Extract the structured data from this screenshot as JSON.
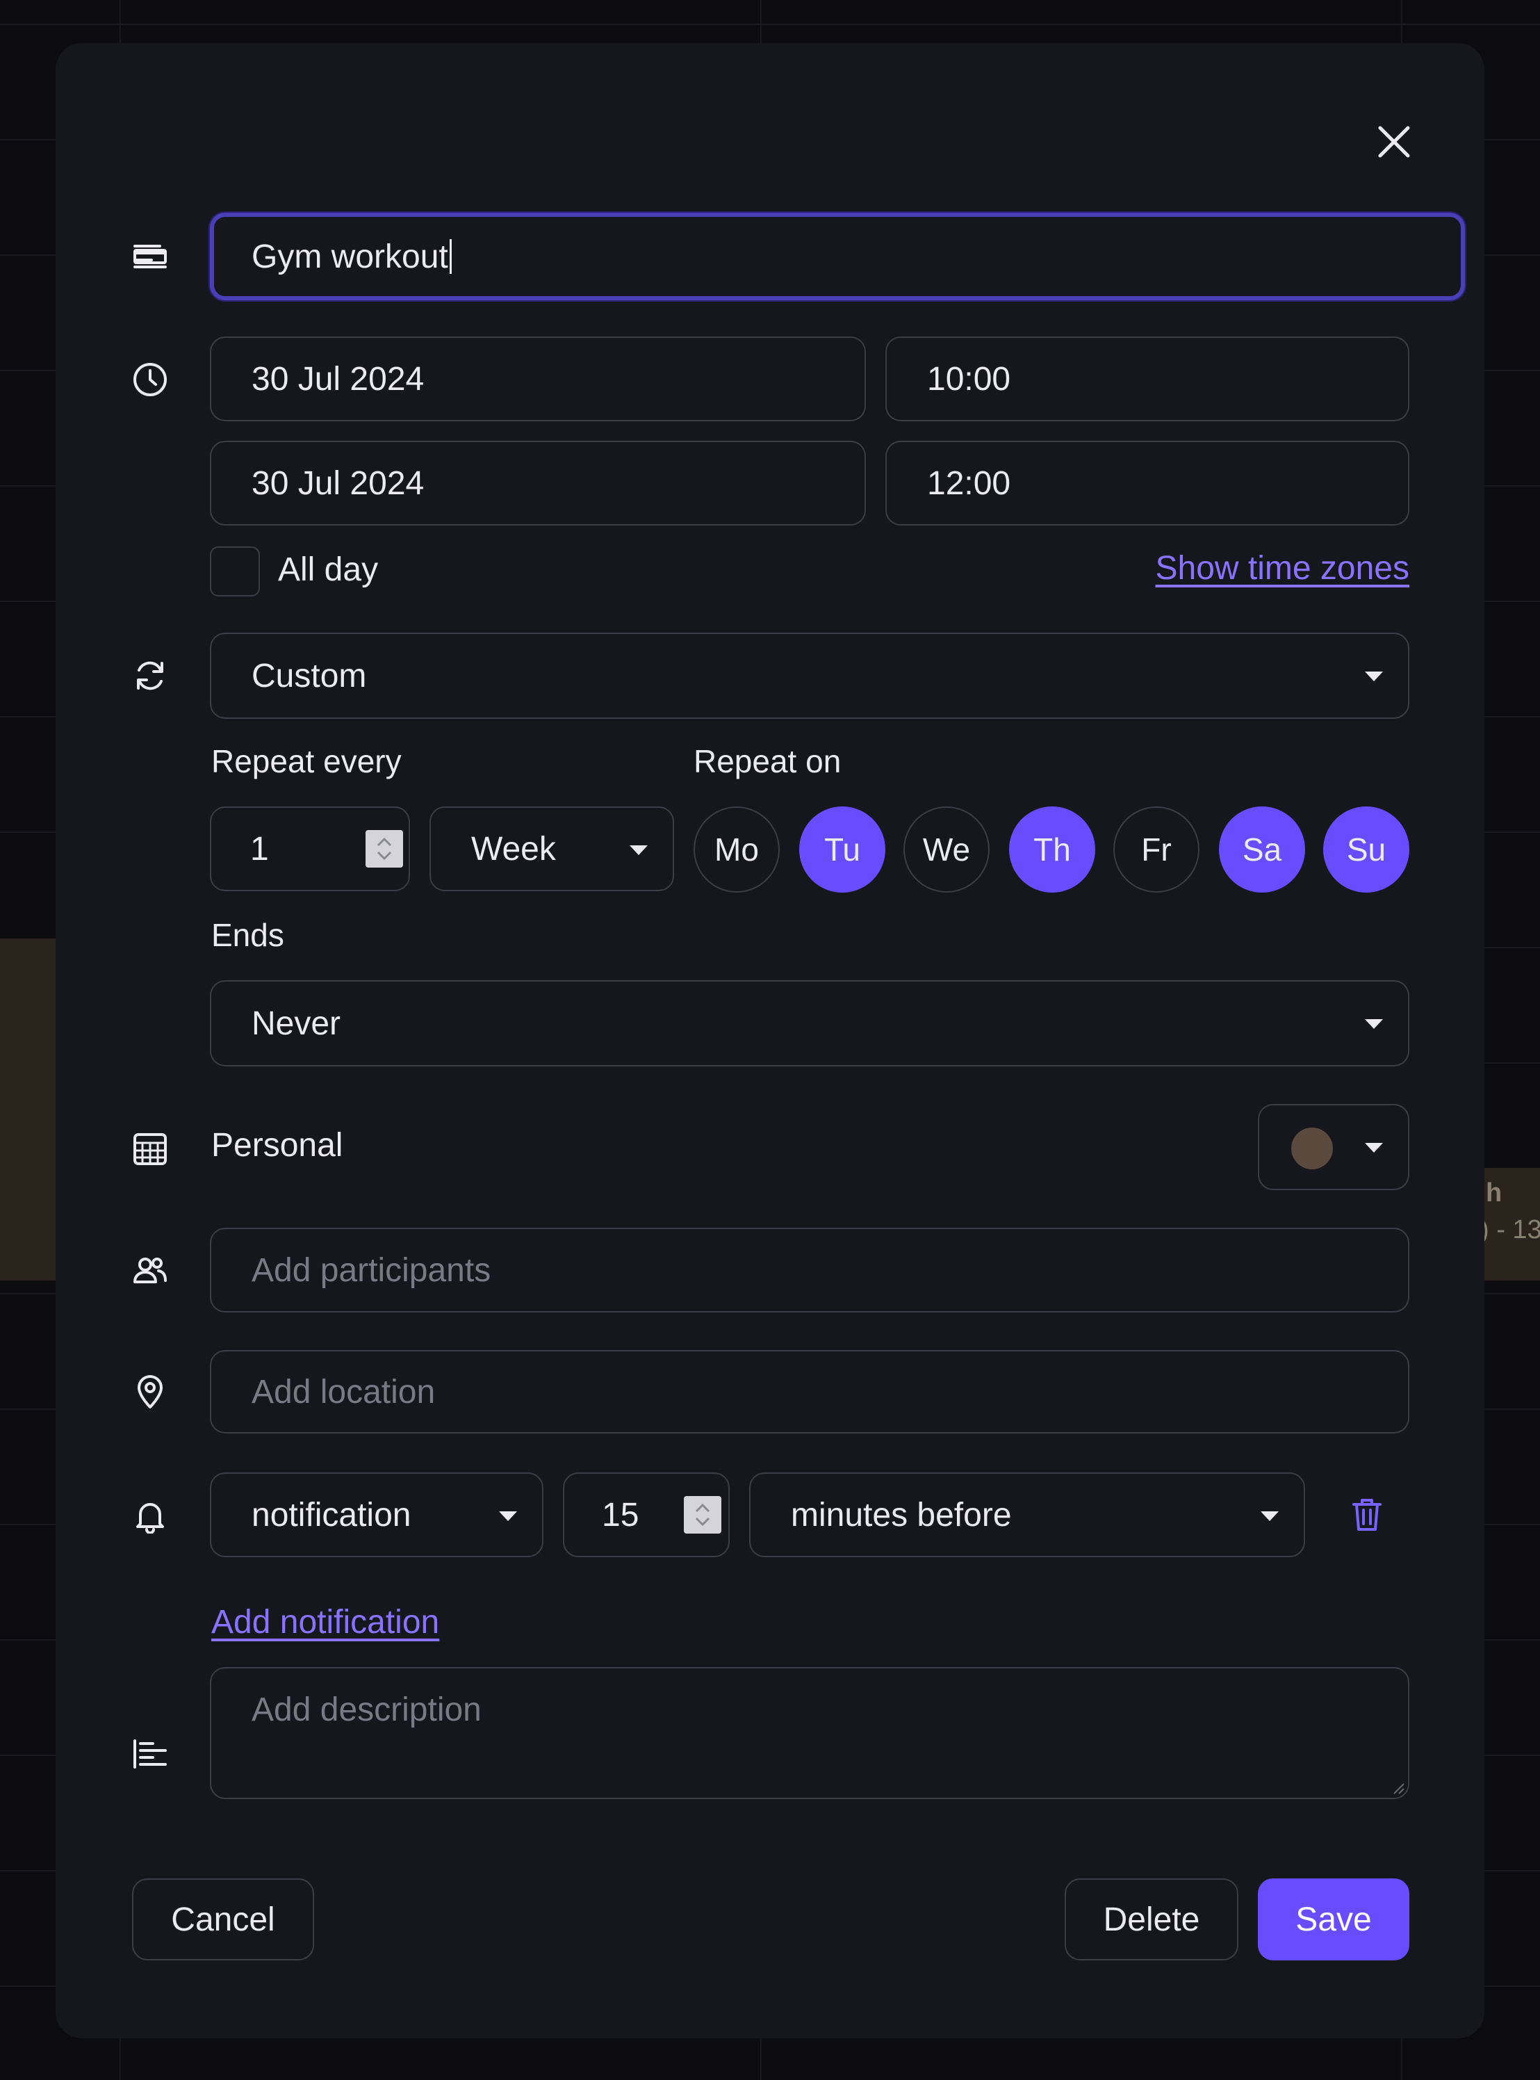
{
  "dialog": {
    "close_icon": "close-icon",
    "title_input": {
      "value": "Gym workout",
      "icon": "text-lines-icon"
    },
    "start_date": "30 Jul 2024",
    "start_time": "10:00",
    "end_date": "30 Jul 2024",
    "end_time": "12:00",
    "time_icon": "clock-icon",
    "all_day": {
      "label": "All day",
      "checked": false
    },
    "show_time_zones": "Show time zones",
    "recurrence": {
      "icon": "repeat-icon",
      "value": "Custom"
    },
    "repeat_every": {
      "label": "Repeat every",
      "count": "1",
      "unit": "Week"
    },
    "repeat_on": {
      "label": "Repeat on",
      "days": [
        {
          "label": "Mo",
          "selected": false
        },
        {
          "label": "Tu",
          "selected": true
        },
        {
          "label": "We",
          "selected": false
        },
        {
          "label": "Th",
          "selected": true
        },
        {
          "label": "Fr",
          "selected": false
        },
        {
          "label": "Sa",
          "selected": true
        },
        {
          "label": "Su",
          "selected": true
        }
      ]
    },
    "ends": {
      "label": "Ends",
      "value": "Never"
    },
    "calendar": {
      "icon": "calendar-icon",
      "name": "Personal",
      "color": "#5a4a3e"
    },
    "participants": {
      "icon": "people-icon",
      "placeholder": "Add participants"
    },
    "location": {
      "icon": "location-pin-icon",
      "placeholder": "Add location"
    },
    "notification": {
      "icon": "bell-icon",
      "type": "notification",
      "amount": "15",
      "unit": "minutes before",
      "delete_icon": "trash-icon",
      "add_label": "Add notification"
    },
    "description": {
      "icon": "align-left-icon",
      "placeholder": "Add description"
    },
    "buttons": {
      "cancel": "Cancel",
      "delete": "Delete",
      "save": "Save"
    }
  },
  "background": {
    "event_fragment_1": "h",
    "event_fragment_2": ") - 13"
  },
  "colors": {
    "accent": "#6a4cff",
    "link": "#8a72ff",
    "surface": "#16161d",
    "border": "#3d3d47"
  }
}
